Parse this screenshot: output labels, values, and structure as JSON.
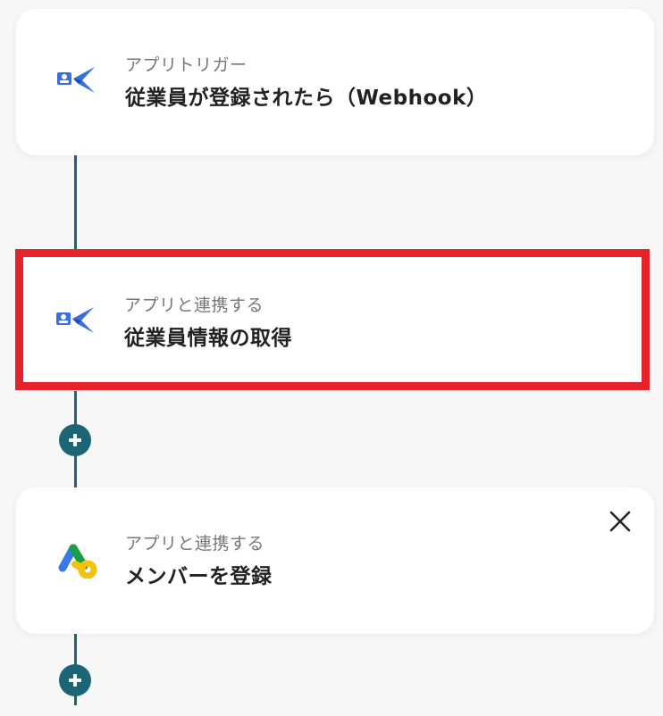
{
  "steps": [
    {
      "subtitle": "アプリトリガー",
      "title": "従業員が登録されたら（Webhook）",
      "icon": "app-logo-icon"
    },
    {
      "subtitle": "アプリと連携する",
      "title": "従業員情報の取得",
      "icon": "app-logo-icon",
      "selected": true
    },
    {
      "subtitle": "アプリと連携する",
      "title": "メンバーを登録",
      "icon": "google-workspace-icon"
    }
  ],
  "colors": {
    "connector": "#1b6577",
    "highlight": "#e8222a",
    "card": "#ffffff",
    "background": "#f7f7f7"
  }
}
